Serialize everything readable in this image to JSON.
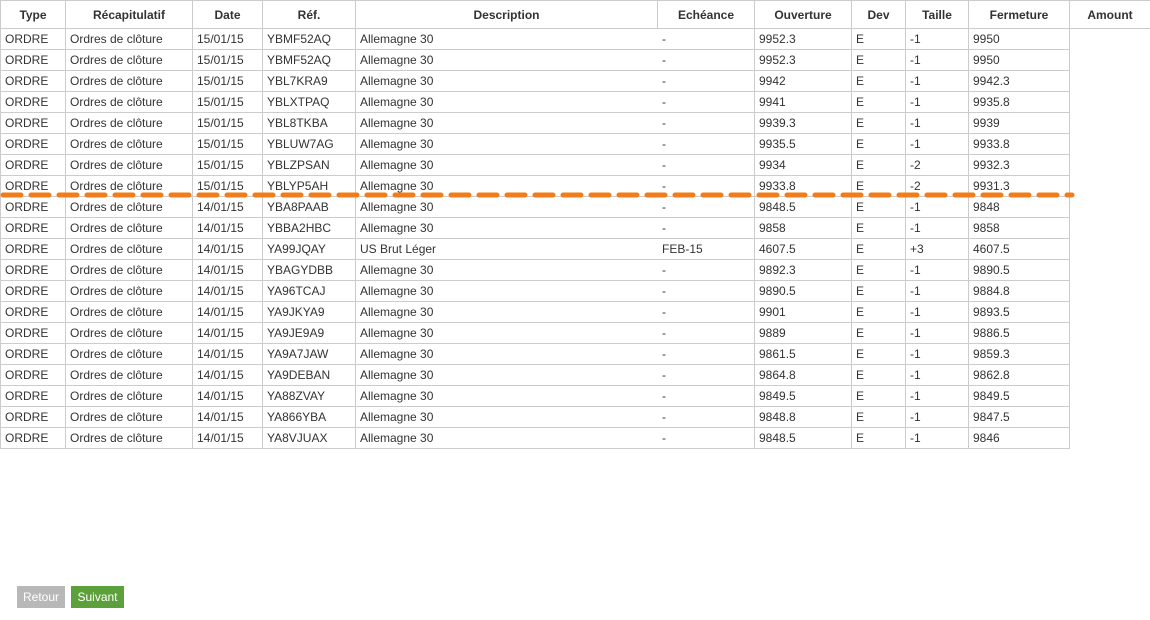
{
  "table": {
    "columns": [
      "Type",
      "Récapitulatif",
      "Date",
      "Réf.",
      "Description",
      "Echéance",
      "Ouverture",
      "Dev",
      "Taille",
      "Fermeture",
      "Amount"
    ],
    "rows": [
      {
        "type": "ORDRE",
        "recap": "Ordres de clôture",
        "date": "15/01/15",
        "ref": "YBMF52AQ",
        "desc": "Allemagne 30",
        "echeance": "-",
        "ouverture": "9952.3",
        "dev": "E",
        "taille": "-1",
        "fermeture": "9950",
        "amount": ""
      },
      {
        "type": "ORDRE",
        "recap": "Ordres de clôture",
        "date": "15/01/15",
        "ref": "YBMF52AQ",
        "desc": "Allemagne 30",
        "echeance": "-",
        "ouverture": "9952.3",
        "dev": "E",
        "taille": "-1",
        "fermeture": "9950",
        "amount": ""
      },
      {
        "type": "ORDRE",
        "recap": "Ordres de clôture",
        "date": "15/01/15",
        "ref": "YBL7KRA9",
        "desc": "Allemagne 30",
        "echeance": "-",
        "ouverture": "9942",
        "dev": "E",
        "taille": "-1",
        "fermeture": "9942.3",
        "amount": ""
      },
      {
        "type": "ORDRE",
        "recap": "Ordres de clôture",
        "date": "15/01/15",
        "ref": "YBLXTPAQ",
        "desc": "Allemagne 30",
        "echeance": "-",
        "ouverture": "9941",
        "dev": "E",
        "taille": "-1",
        "fermeture": "9935.8",
        "amount": ""
      },
      {
        "type": "ORDRE",
        "recap": "Ordres de clôture",
        "date": "15/01/15",
        "ref": "YBL8TKBA",
        "desc": "Allemagne 30",
        "echeance": "-",
        "ouverture": "9939.3",
        "dev": "E",
        "taille": "-1",
        "fermeture": "9939",
        "amount": ""
      },
      {
        "type": "ORDRE",
        "recap": "Ordres de clôture",
        "date": "15/01/15",
        "ref": "YBLUW7AG",
        "desc": "Allemagne 30",
        "echeance": "-",
        "ouverture": "9935.5",
        "dev": "E",
        "taille": "-1",
        "fermeture": "9933.8",
        "amount": ""
      },
      {
        "type": "ORDRE",
        "recap": "Ordres de clôture",
        "date": "15/01/15",
        "ref": "YBLZPSAN",
        "desc": "Allemagne 30",
        "echeance": "-",
        "ouverture": "9934",
        "dev": "E",
        "taille": "-2",
        "fermeture": "9932.3",
        "amount": ""
      },
      {
        "type": "ORDRE",
        "recap": "Ordres de clôture",
        "date": "15/01/15",
        "ref": "YBLYP5AH",
        "desc": "Allemagne 30",
        "echeance": "-",
        "ouverture": "9933.8",
        "dev": "E",
        "taille": "-2",
        "fermeture": "9931.3",
        "amount": ""
      },
      {
        "type": "ORDRE",
        "recap": "Ordres de clôture",
        "date": "14/01/15",
        "ref": "YBA8PAAB",
        "desc": "Allemagne 30",
        "echeance": "-",
        "ouverture": "9848.5",
        "dev": "E",
        "taille": "-1",
        "fermeture": "9848",
        "amount": ""
      },
      {
        "type": "ORDRE",
        "recap": "Ordres de clôture",
        "date": "14/01/15",
        "ref": "YBBA2HBC",
        "desc": "Allemagne 30",
        "echeance": "-",
        "ouverture": "9858",
        "dev": "E",
        "taille": "-1",
        "fermeture": "9858",
        "amount": ""
      },
      {
        "type": "ORDRE",
        "recap": "Ordres de clôture",
        "date": "14/01/15",
        "ref": "YA99JQAY",
        "desc": "US Brut Léger",
        "echeance": "FEB-15",
        "ouverture": "4607.5",
        "dev": "E",
        "taille": "+3",
        "fermeture": "4607.5",
        "amount": ""
      },
      {
        "type": "ORDRE",
        "recap": "Ordres de clôture",
        "date": "14/01/15",
        "ref": "YBAGYDBB",
        "desc": "Allemagne 30",
        "echeance": "-",
        "ouverture": "9892.3",
        "dev": "E",
        "taille": "-1",
        "fermeture": "9890.5",
        "amount": ""
      },
      {
        "type": "ORDRE",
        "recap": "Ordres de clôture",
        "date": "14/01/15",
        "ref": "YA96TCAJ",
        "desc": "Allemagne 30",
        "echeance": "-",
        "ouverture": "9890.5",
        "dev": "E",
        "taille": "-1",
        "fermeture": "9884.8",
        "amount": ""
      },
      {
        "type": "ORDRE",
        "recap": "Ordres de clôture",
        "date": "14/01/15",
        "ref": "YA9JKYA9",
        "desc": "Allemagne 30",
        "echeance": "-",
        "ouverture": "9901",
        "dev": "E",
        "taille": "-1",
        "fermeture": "9893.5",
        "amount": ""
      },
      {
        "type": "ORDRE",
        "recap": "Ordres de clôture",
        "date": "14/01/15",
        "ref": "YA9JE9A9",
        "desc": "Allemagne 30",
        "echeance": "-",
        "ouverture": "9889",
        "dev": "E",
        "taille": "-1",
        "fermeture": "9886.5",
        "amount": ""
      },
      {
        "type": "ORDRE",
        "recap": "Ordres de clôture",
        "date": "14/01/15",
        "ref": "YA9A7JAW",
        "desc": "Allemagne 30",
        "echeance": "-",
        "ouverture": "9861.5",
        "dev": "E",
        "taille": "-1",
        "fermeture": "9859.3",
        "amount": ""
      },
      {
        "type": "ORDRE",
        "recap": "Ordres de clôture",
        "date": "14/01/15",
        "ref": "YA9DEBAN",
        "desc": "Allemagne 30",
        "echeance": "-",
        "ouverture": "9864.8",
        "dev": "E",
        "taille": "-1",
        "fermeture": "9862.8",
        "amount": ""
      },
      {
        "type": "ORDRE",
        "recap": "Ordres de clôture",
        "date": "14/01/15",
        "ref": "YA88ZVAY",
        "desc": "Allemagne 30",
        "echeance": "-",
        "ouverture": "9849.5",
        "dev": "E",
        "taille": "-1",
        "fermeture": "9849.5",
        "amount": ""
      },
      {
        "type": "ORDRE",
        "recap": "Ordres de clôture",
        "date": "14/01/15",
        "ref": "YA866YBA",
        "desc": "Allemagne 30",
        "echeance": "-",
        "ouverture": "9848.8",
        "dev": "E",
        "taille": "-1",
        "fermeture": "9847.5",
        "amount": ""
      },
      {
        "type": "ORDRE",
        "recap": "Ordres de clôture",
        "date": "14/01/15",
        "ref": "YA8VJUAX",
        "desc": "Allemagne 30",
        "echeance": "-",
        "ouverture": "9848.5",
        "dev": "E",
        "taille": "-1",
        "fermeture": "9846",
        "amount": ""
      }
    ]
  },
  "annotation": {
    "dashed_line_color": "#f07d1a"
  },
  "buttons": {
    "back_label": "Retour",
    "next_label": "Suivant"
  },
  "colors": {
    "back_button": "#b8b8b8",
    "next_button": "#5ca03b",
    "border": "#cccccc"
  }
}
